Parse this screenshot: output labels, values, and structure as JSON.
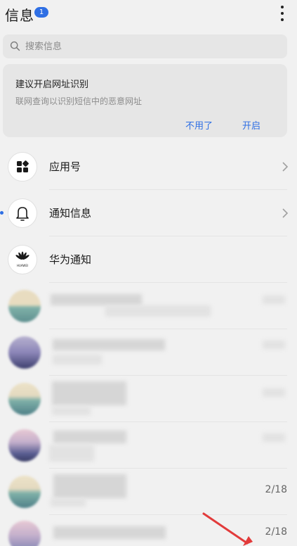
{
  "header": {
    "title": "信息",
    "badge": "1"
  },
  "search": {
    "placeholder": "搜索信息"
  },
  "card": {
    "title": "建议开启网址识别",
    "subtitle": "联网查询以识别短信中的恶意网址",
    "dismiss_label": "不用了",
    "enable_label": "开启"
  },
  "rows": [
    {
      "label": "应用号",
      "icon": "apps-grid-icon"
    },
    {
      "label": "通知信息",
      "icon": "bell-icon"
    },
    {
      "label": "华为通知",
      "icon": "huawei-logo"
    }
  ],
  "huawei_logo_text": "HUAWEI",
  "conversations": [
    {
      "date": ""
    },
    {
      "date": ""
    },
    {
      "date": ""
    },
    {
      "date": ""
    },
    {
      "date": "2/18"
    },
    {
      "date": "2/18"
    }
  ],
  "colors": {
    "accent": "#2f6fe4",
    "background": "#f1f1f1",
    "card": "#e6e6e6",
    "arrow": "#e23b3b"
  }
}
